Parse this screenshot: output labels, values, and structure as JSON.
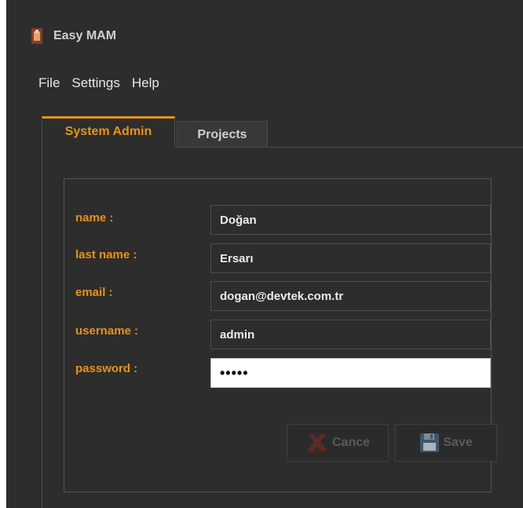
{
  "window": {
    "title": "Easy MAM",
    "icon": "app-logo-icon"
  },
  "menu": {
    "items": [
      "File",
      "Settings",
      "Help"
    ]
  },
  "tabs": [
    {
      "label": "System Admin",
      "active": true
    },
    {
      "label": "Projects",
      "active": false
    }
  ],
  "form": {
    "fields": [
      {
        "label": "name :",
        "value": "Doğan"
      },
      {
        "label": "last name :",
        "value": "Ersarı"
      },
      {
        "label": "email :",
        "value": "dogan@devtek.com.tr"
      },
      {
        "label": "username :",
        "value": "admin"
      },
      {
        "label": "password :",
        "value": "•••••",
        "focused": true
      }
    ]
  },
  "buttons": {
    "cancel_label": "Cancel",
    "cancel_icon": "cancel-x-icon",
    "save_label": "Save",
    "save_icon": "floppy-disk-icon",
    "enabled": false
  },
  "colors": {
    "accent": "#e7921c",
    "background": "#2d2d2d",
    "text": "#e8e8e8"
  }
}
